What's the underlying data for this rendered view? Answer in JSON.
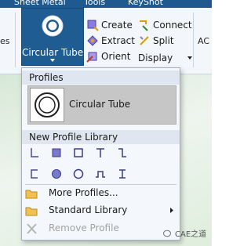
{
  "colors": {
    "tab_strip": "#1e5a8f",
    "big_button_bg": "#1f5c92",
    "ribbon_bg": "#f3f6fa",
    "menu_bg": "#f4f7fb",
    "section_header_bg": "#dfe6ef",
    "selected_item_bg": "#c6c6c6",
    "shape_fill": "#7a7acc",
    "canvas_bg": "#e4f0e2"
  },
  "ribbon_tabs": [
    "Sheet Metal",
    "Tools",
    "KeyShot"
  ],
  "ribbon": {
    "left_stub": "es",
    "right_stub": "AC",
    "big_button": {
      "label": "Circular Tube",
      "icon": "circle-ring-icon"
    },
    "small_buttons": [
      {
        "label": "Create",
        "icon": "create-profile-icon"
      },
      {
        "label": "Extract",
        "icon": "extract-profile-icon"
      },
      {
        "label": "Orient",
        "icon": "orient-profile-icon"
      },
      {
        "label": "Connect",
        "icon": "connect-profile-icon"
      },
      {
        "label": "Split",
        "icon": "split-profile-icon"
      },
      {
        "label": "Display",
        "icon": "dropdown-caret-icon"
      }
    ]
  },
  "menu": {
    "profiles_header": "Profiles",
    "selected_profile": "Circular Tube",
    "library_header": "New Profile Library",
    "shape_rows": [
      [
        "angle-icon",
        "square-solid-icon",
        "square-outline-icon",
        "t-section-icon",
        "z-section-icon"
      ],
      [
        "channel-icon",
        "circle-solid-icon",
        "circle-outline-icon",
        "hat-section-icon",
        "i-beam-icon"
      ]
    ],
    "items": [
      {
        "label": "More Profiles...",
        "icon": "folder-icon"
      },
      {
        "label": "Standard Library",
        "icon": "folder-icon",
        "has_submenu": true
      },
      {
        "label": "Remove Profile",
        "icon": "remove-x-icon",
        "disabled": true
      }
    ]
  },
  "watermark": "CAE之道"
}
